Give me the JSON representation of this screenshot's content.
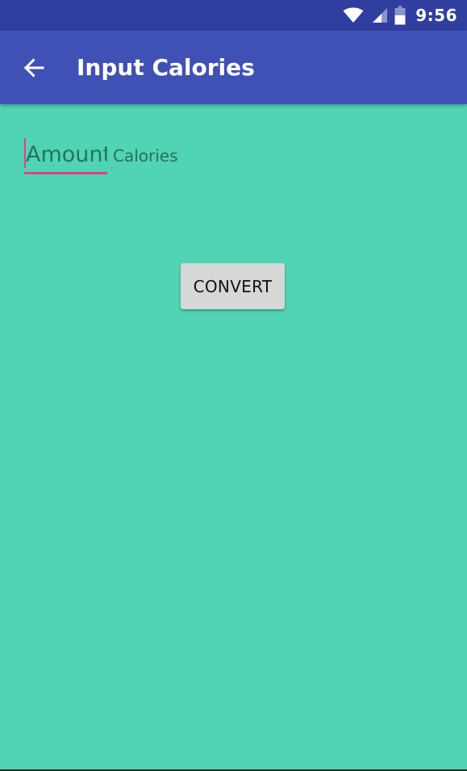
{
  "status_bar": {
    "time": "9:56",
    "icons": [
      "wifi-icon",
      "cellular-signal-icon",
      "battery-icon"
    ],
    "color": "#303f9f"
  },
  "app_bar": {
    "title": "Input Calories",
    "back_icon": "arrow-left-icon",
    "color": "#3f51b5"
  },
  "form": {
    "amount_placeholder": "Amount",
    "amount_value": "",
    "unit_label": "Calories",
    "convert_label": "CONVERT"
  },
  "theme": {
    "background": "#50d4b4",
    "accent": "#e83e8c",
    "button": "#d6d7d7"
  }
}
